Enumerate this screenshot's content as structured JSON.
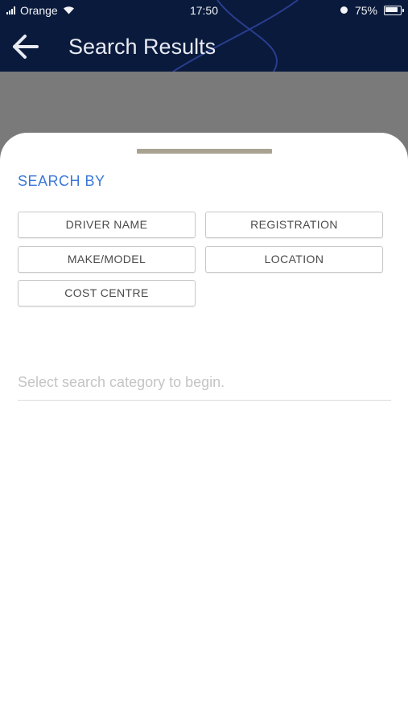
{
  "status_bar": {
    "carrier": "Orange",
    "time": "17:50",
    "battery": "75%"
  },
  "header": {
    "title": "Search Results",
    "back_icon": "arrow-left-icon"
  },
  "sheet": {
    "search_by_label": "SEARCH BY",
    "categories": [
      {
        "label": "DRIVER NAME"
      },
      {
        "label": "REGISTRATION"
      },
      {
        "label": "MAKE/MODEL"
      },
      {
        "label": "LOCATION"
      },
      {
        "label": "COST CENTRE"
      }
    ],
    "search": {
      "placeholder": "Select search category to begin.",
      "value": ""
    }
  },
  "colors": {
    "header_bg": "#0a1a3c",
    "accent": "#3b78d8",
    "overlay": "#7a7a7a",
    "handle": "#a8a390"
  }
}
